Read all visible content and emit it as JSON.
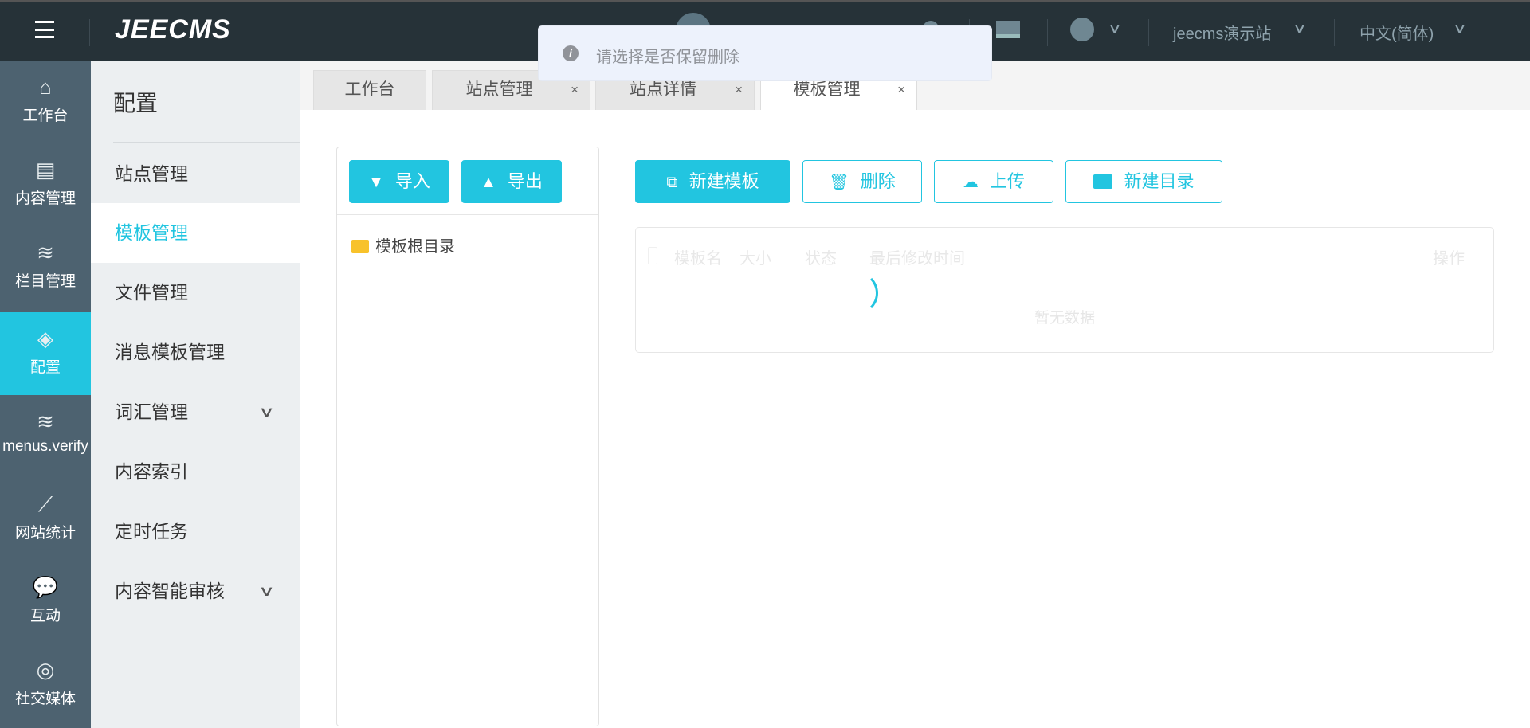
{
  "header": {
    "logo": "JEECMS",
    "site": "jeecms演示站",
    "language": "中文(简体)"
  },
  "toast": {
    "message": "请选择是否保留删除"
  },
  "rail": [
    {
      "label": "工作台",
      "icon": "home-icon"
    },
    {
      "label": "内容管理",
      "icon": "document-icon"
    },
    {
      "label": "栏目管理",
      "icon": "layers-icon"
    },
    {
      "label": "配置",
      "icon": "cube-icon",
      "active": true
    },
    {
      "label": "menus.verify",
      "icon": "layers-icon"
    },
    {
      "label": "网站统计",
      "icon": "chart-icon"
    },
    {
      "label": "互动",
      "icon": "chat-icon"
    },
    {
      "label": "社交媒体",
      "icon": "social-icon"
    }
  ],
  "side": {
    "title": "配置",
    "items": [
      {
        "label": "站点管理"
      },
      {
        "label": "模板管理",
        "active": true
      },
      {
        "label": "文件管理"
      },
      {
        "label": "消息模板管理"
      },
      {
        "label": "词汇管理",
        "expand": true
      },
      {
        "label": "内容索引"
      },
      {
        "label": "定时任务"
      },
      {
        "label": "内容智能审核",
        "expand": true
      }
    ]
  },
  "tabs": [
    {
      "label": "工作台"
    },
    {
      "label": "站点管理",
      "close": "×"
    },
    {
      "label": "站点详情",
      "close": "×"
    },
    {
      "label": "模板管理",
      "close": "×",
      "active": true
    }
  ],
  "left": {
    "import": "导入",
    "export": "导出",
    "root": "模板根目录"
  },
  "toolbar": {
    "new_template": "新建模板",
    "delete": "删除",
    "upload": "上传",
    "new_dir": "新建目录"
  },
  "table": {
    "columns": [
      "模板名",
      "大小",
      "状态",
      "最后修改时间",
      "操作"
    ],
    "empty": "暂无数据"
  },
  "colors": {
    "accent": "#22c5e0",
    "header": "#263238",
    "rail": "#4d6270"
  }
}
